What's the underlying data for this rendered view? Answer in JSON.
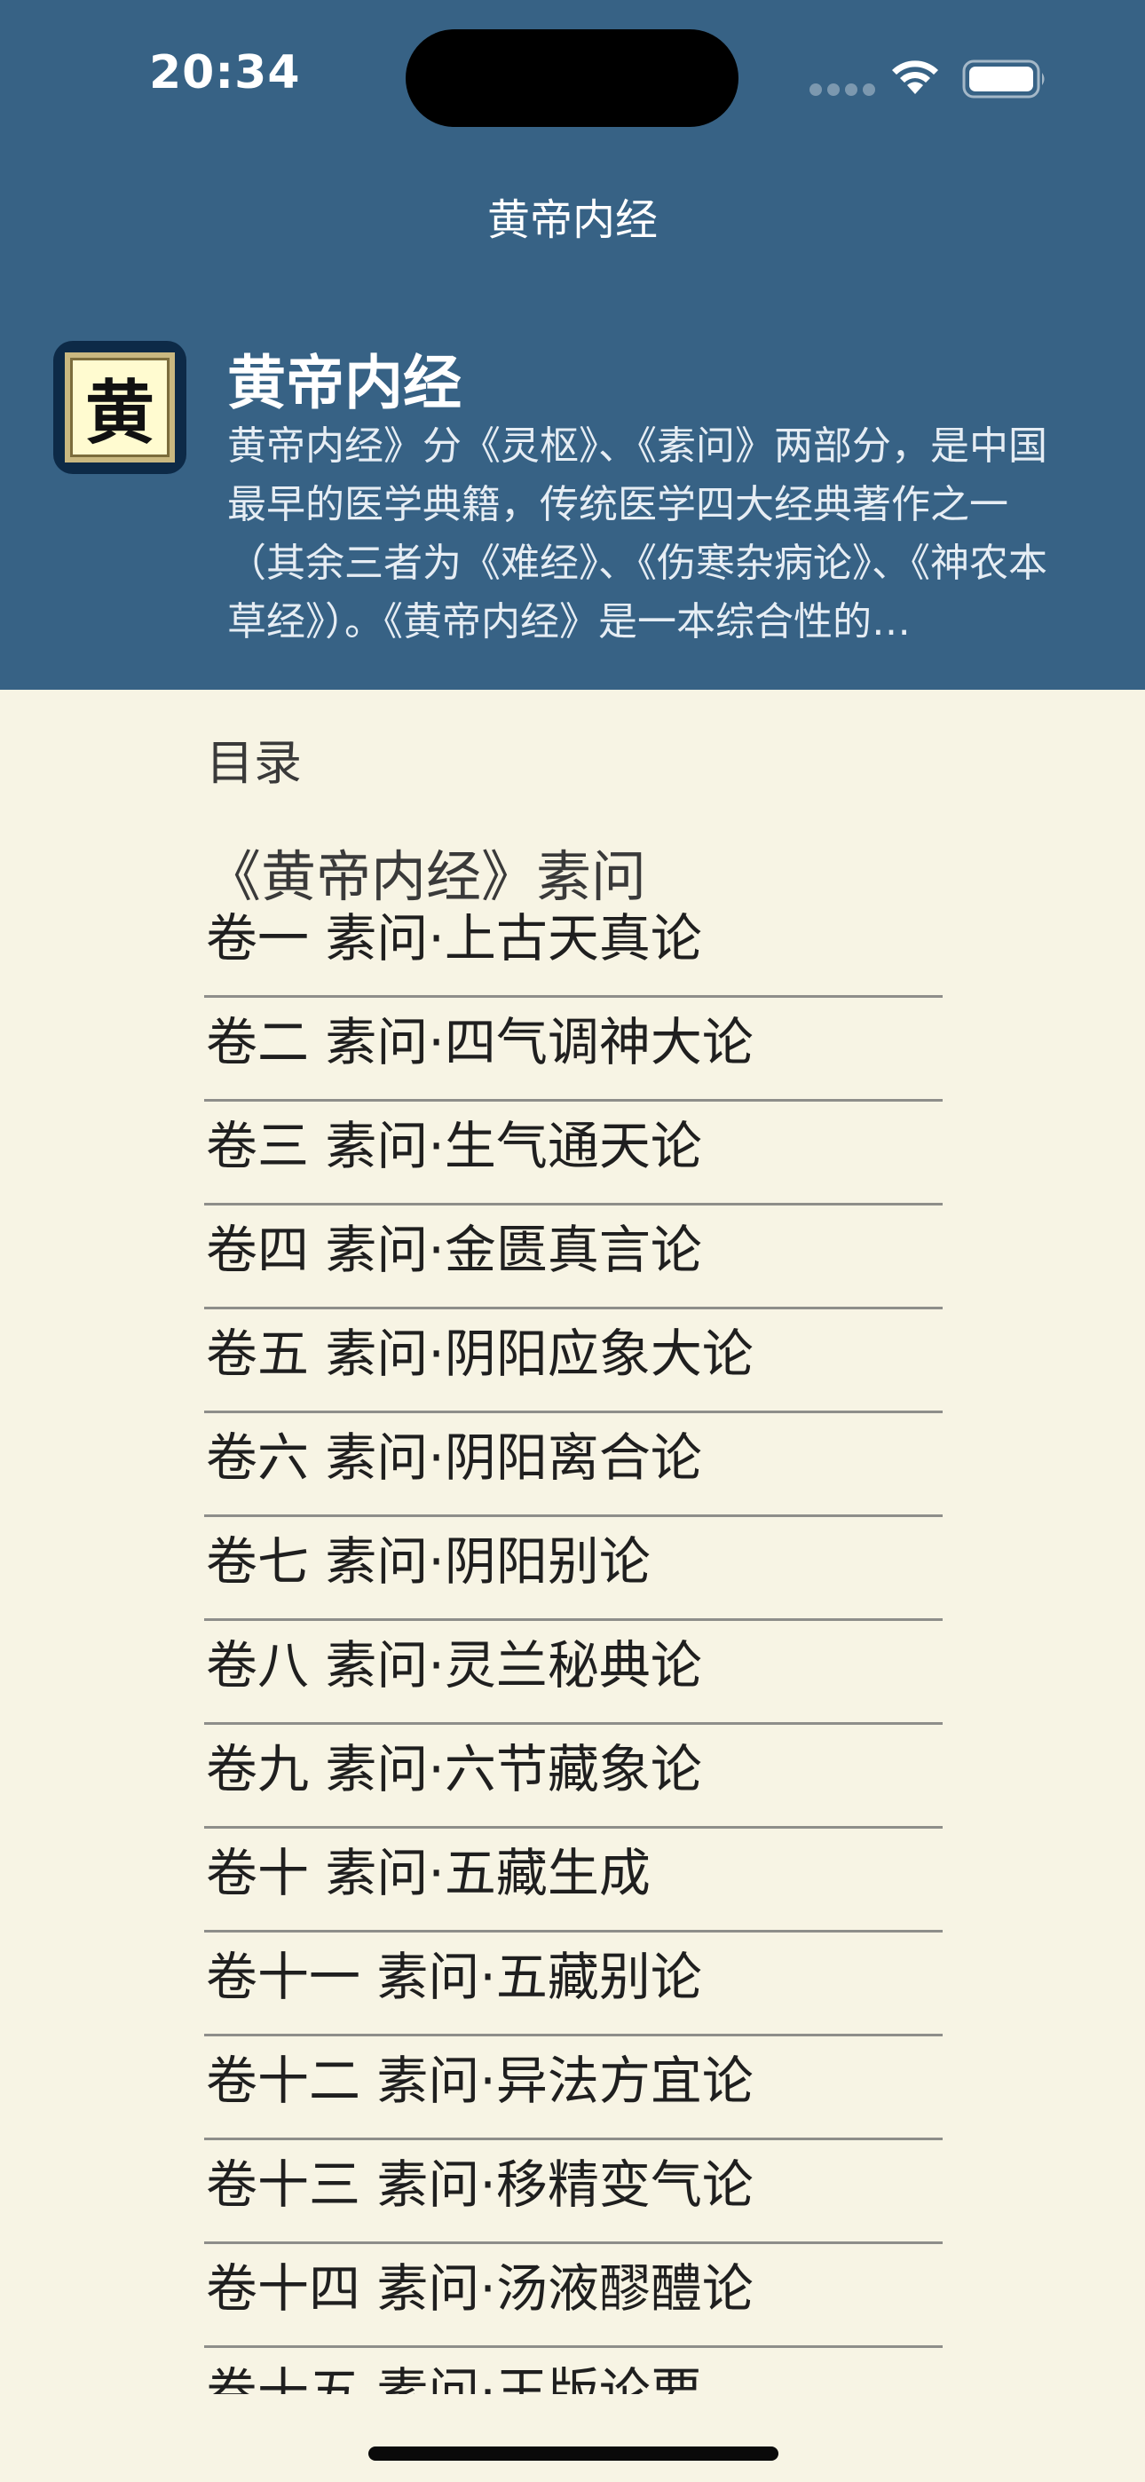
{
  "status_bar": {
    "time": "20:34"
  },
  "nav": {
    "title": "黄帝内经"
  },
  "book": {
    "icon_char": "黄",
    "title": "黄帝内经",
    "description": "黄帝内经》分《灵枢》、《素问》两部分，是中国最早的医学典籍，传统医学四大经典著作之一（其余三者为《难经》、《伤寒杂病论》、《神农本草经》）。《黄帝内经》是一本综合性的…"
  },
  "toc": {
    "label": "目录",
    "section_title": "《黄帝内经》素问",
    "chapters": [
      "卷一 素问·上古天真论",
      "卷二 素问·四气调神大论",
      "卷三 素问·生气通天论",
      "卷四 素问·金匮真言论",
      "卷五 素问·阴阳应象大论",
      "卷六 素问·阴阳离合论",
      "卷七 素问·阴阳别论",
      "卷八 素问·灵兰秘典论",
      "卷九 素问·六节藏象论",
      "卷十 素问·五藏生成",
      "卷十一 素问·五藏别论",
      "卷十二 素问·异法方宜论",
      "卷十三 素问·移精变气论",
      "卷十四 素问·汤液醪醴论",
      "卷十五 素问·玉版论要"
    ]
  },
  "colors": {
    "header_bg": "#376285",
    "page_bg": "#f7f4e4",
    "icon_bg": "#0d2a47"
  },
  "icons": [
    "wifi-icon",
    "battery-icon",
    "cellular-signal-icon"
  ]
}
